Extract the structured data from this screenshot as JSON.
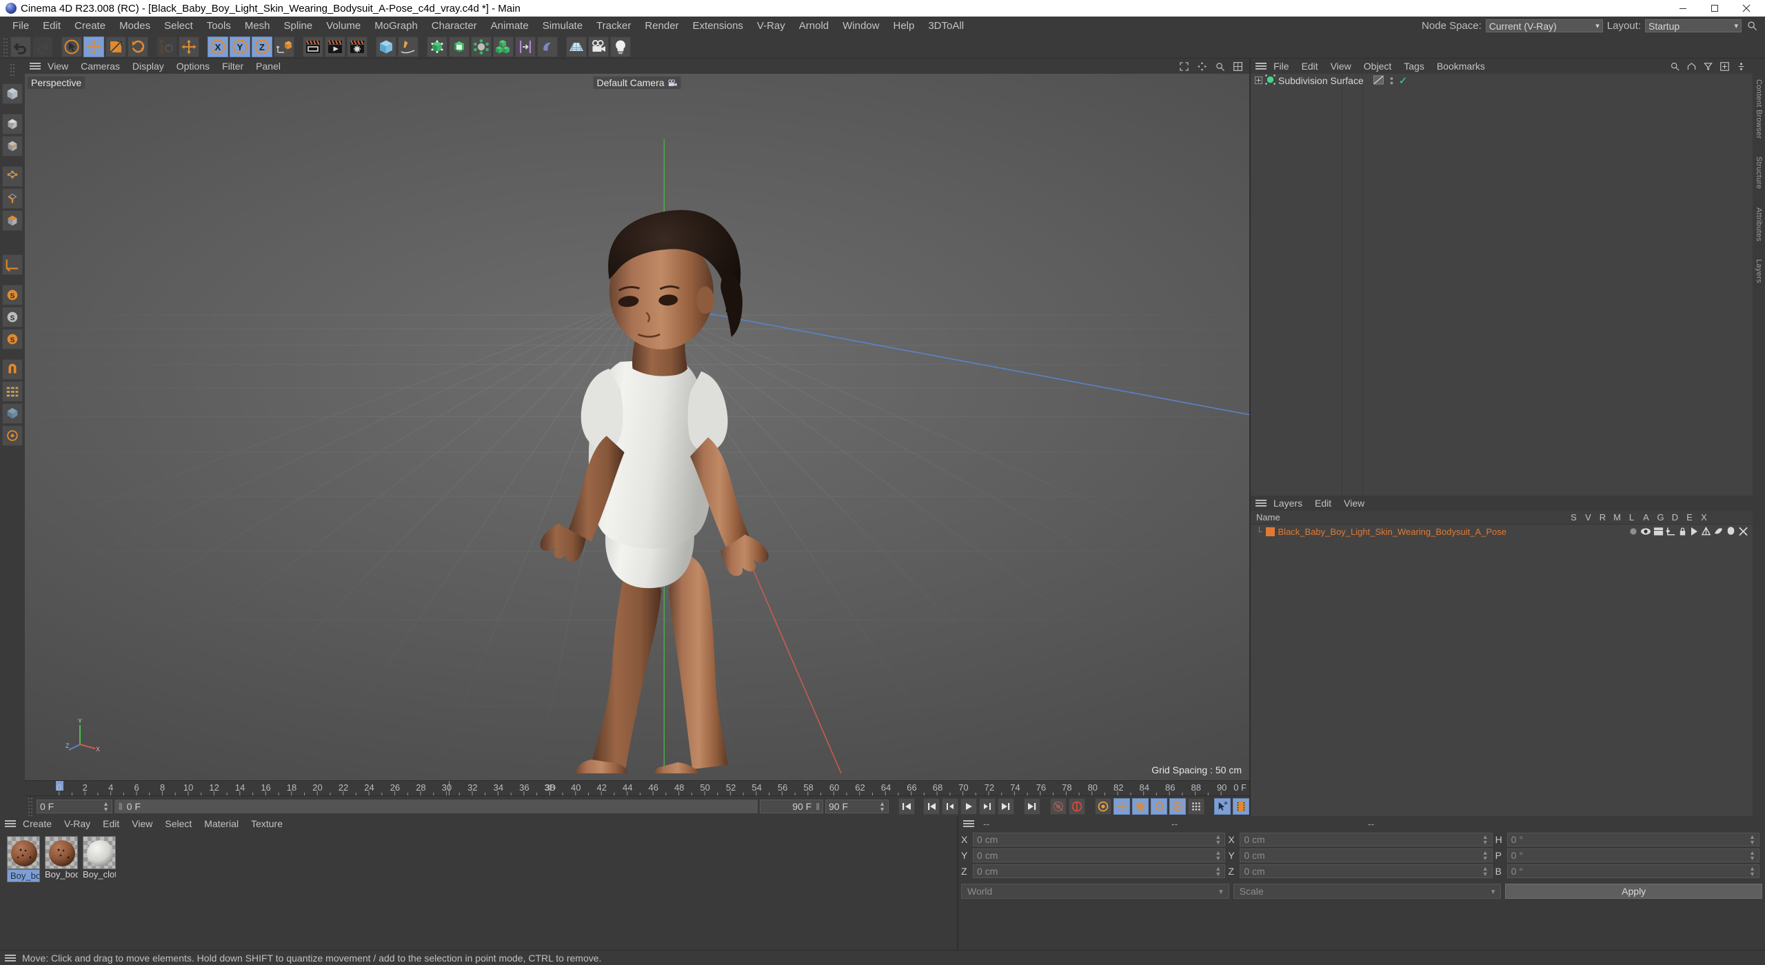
{
  "window": {
    "title": "Cinema 4D R23.008 (RC) - [Black_Baby_Boy_Light_Skin_Wearing_Bodysuit_A-Pose_c4d_vray.c4d *] - Main",
    "minimize": "–",
    "maximize": "❐",
    "close": "✕"
  },
  "menubar": {
    "items": [
      "File",
      "Edit",
      "Create",
      "Modes",
      "Select",
      "Tools",
      "Mesh",
      "Spline",
      "Volume",
      "MoGraph",
      "Character",
      "Animate",
      "Simulate",
      "Tracker",
      "Render",
      "Extensions",
      "V-Ray",
      "Arnold",
      "Window",
      "Help",
      "3DToAll"
    ]
  },
  "topright": {
    "node_space_label": "Node Space:",
    "node_space_value": "Current (V-Ray)",
    "layout_label": "Layout:",
    "layout_value": "Startup",
    "search_icon": "search-icon"
  },
  "toolbar": {
    "groups": [
      {
        "buttons": [
          {
            "name": "undo-button",
            "icon": "undo",
            "state": "normal"
          },
          {
            "name": "redo-button",
            "icon": "redo",
            "state": "disabled"
          }
        ]
      },
      {
        "buttons": [
          {
            "name": "live-selection-tool",
            "icon": "cursor-circle",
            "state": "normal"
          },
          {
            "name": "move-tool",
            "icon": "move",
            "state": "active"
          },
          {
            "name": "scale-tool",
            "icon": "scale",
            "state": "normal"
          },
          {
            "name": "rotate-tool",
            "icon": "rotate",
            "state": "normal"
          }
        ]
      },
      {
        "buttons": [
          {
            "name": "psr-dropdown",
            "icon": "psr",
            "state": "disabled"
          },
          {
            "name": "move-alt-tool",
            "icon": "move",
            "state": "normal"
          }
        ]
      },
      {
        "buttons": [
          {
            "name": "x-axis-lock",
            "icon": "axis-x",
            "state": "active"
          },
          {
            "name": "y-axis-lock",
            "icon": "axis-y",
            "state": "active"
          },
          {
            "name": "z-axis-lock",
            "icon": "axis-z",
            "state": "active"
          },
          {
            "name": "world-object-axis",
            "icon": "world-axis",
            "state": "normal"
          }
        ]
      },
      {
        "buttons": [
          {
            "name": "render-view-button",
            "icon": "render-view",
            "state": "normal"
          },
          {
            "name": "render-to-picture-viewer-button",
            "icon": "render-picture",
            "state": "normal"
          },
          {
            "name": "render-settings-button",
            "icon": "render-settings",
            "state": "normal"
          }
        ]
      },
      {
        "buttons": [
          {
            "name": "add-cube-button",
            "icon": "cube-blue",
            "state": "normal"
          },
          {
            "name": "add-spline-button",
            "icon": "pen",
            "state": "normal"
          }
        ]
      },
      {
        "buttons": [
          {
            "name": "add-nurbs-button",
            "icon": "nurbs",
            "state": "normal"
          },
          {
            "name": "add-array-button",
            "icon": "array",
            "state": "normal"
          },
          {
            "name": "add-deformer-button",
            "icon": "deformer",
            "state": "normal"
          },
          {
            "name": "add-mograph-button",
            "icon": "mograph",
            "state": "normal"
          },
          {
            "name": "add-field-button",
            "icon": "field",
            "state": "normal"
          },
          {
            "name": "add-scene-button",
            "icon": "scene",
            "state": "normal"
          }
        ]
      },
      {
        "buttons": [
          {
            "name": "add-floor-button",
            "icon": "floor",
            "state": "normal"
          },
          {
            "name": "add-camera-button",
            "icon": "camera",
            "state": "normal"
          },
          {
            "name": "add-light-button",
            "icon": "light",
            "state": "normal"
          }
        ]
      }
    ]
  },
  "lefttoolbar": {
    "buttons": [
      {
        "name": "make-editable-button",
        "icon": "make-editable"
      },
      {
        "name": "model-mode-button",
        "icon": "model-mode"
      },
      {
        "name": "texture-mode-button",
        "icon": "texture-mode"
      },
      {
        "name": "points-mode-button",
        "icon": "points-mode"
      },
      {
        "name": "edges-mode-button",
        "icon": "edges-mode"
      },
      {
        "name": "polygons-mode-button",
        "icon": "polygons-mode"
      },
      {
        "name": "workplane-button",
        "icon": "workplane"
      },
      {
        "name": "axis-lock-button",
        "icon": "axis-lock"
      },
      {
        "name": "enable-axis-button",
        "icon": "enable-axis"
      },
      {
        "name": "viewport-solo-single-button",
        "icon": "solo-single"
      },
      {
        "name": "viewport-solo-hierarchy-button",
        "icon": "solo-hierarchy"
      },
      {
        "name": "viewport-solo-off-button",
        "icon": "solo-off"
      },
      {
        "name": "snap-button",
        "icon": "snap-magnet"
      },
      {
        "name": "quantize-button",
        "icon": "quantize"
      },
      {
        "name": "workplane-lock-button",
        "icon": "workplane-lock"
      },
      {
        "name": "layout-preset-button",
        "icon": "layout-preset"
      }
    ]
  },
  "viewport": {
    "menu": [
      "View",
      "Cameras",
      "Display",
      "Options",
      "Filter",
      "Panel"
    ],
    "perspective_label": "Perspective",
    "camera_label": "Default Camera",
    "camera_icon": "camera-icon",
    "grid_spacing": "Grid Spacing : 50 cm",
    "axis_gizmo": {
      "y": "Y",
      "z": "Z",
      "x": "X"
    }
  },
  "timeline": {
    "ticks": [
      0,
      2,
      4,
      6,
      8,
      10,
      12,
      14,
      16,
      18,
      20,
      22,
      24,
      26,
      28,
      30,
      32,
      34,
      36,
      38,
      40,
      42,
      44,
      46,
      48,
      50,
      52,
      54,
      56,
      58,
      60,
      62,
      64,
      66,
      68,
      70,
      72,
      74,
      76,
      78,
      80,
      82,
      84,
      86,
      88,
      90
    ],
    "tick_3d_label": "3D",
    "current_frame_label": "0 F",
    "playhead_frame": 0,
    "cursor_frame": 30
  },
  "transport": {
    "current_frame": "0 F",
    "preview_range": "0 F",
    "end_frame": "90 F",
    "max_frame": "90 F",
    "buttons": [
      {
        "name": "go-to-start-button",
        "icon": "skip-start"
      },
      {
        "name": "go-to-previous-key-button",
        "icon": "prev-key"
      },
      {
        "name": "go-to-previous-frame-button",
        "icon": "prev-frame"
      },
      {
        "name": "play-button",
        "icon": "play"
      },
      {
        "name": "go-to-next-frame-button",
        "icon": "next-frame"
      },
      {
        "name": "go-to-next-key-button",
        "icon": "next-key"
      },
      {
        "name": "go-to-end-button",
        "icon": "skip-end"
      },
      {
        "name": "record-active-objects-button",
        "icon": "record-disabled"
      },
      {
        "name": "autokeying-button",
        "icon": "autokey"
      },
      {
        "name": "keyframe-selection-button",
        "icon": "keyframe-selection"
      },
      {
        "name": "position-key-button",
        "icon": "position-key"
      },
      {
        "name": "scale-key-button",
        "icon": "scale-key"
      },
      {
        "name": "rotation-key-button",
        "icon": "rotation-key"
      },
      {
        "name": "parameter-key-button",
        "icon": "param-key"
      },
      {
        "name": "point-level-animation-button",
        "icon": "pla"
      },
      {
        "name": "animation-mode-button",
        "icon": "anim-mode"
      },
      {
        "name": "timeline-filmstrip-button",
        "icon": "filmstrip"
      }
    ]
  },
  "material_manager": {
    "menu": [
      "Create",
      "V-Ray",
      "Edit",
      "View",
      "Select",
      "Material",
      "Texture"
    ],
    "materials": [
      {
        "name": "Boy_bod",
        "selected": true,
        "kind": "skin"
      },
      {
        "name": "Boy_bod",
        "selected": false,
        "kind": "skin"
      },
      {
        "name": "Boy_clot",
        "selected": false,
        "kind": "cloth"
      }
    ]
  },
  "coordinates": {
    "header_segments": [
      "--",
      "--",
      "--"
    ],
    "rows": [
      {
        "a_axis": "X",
        "a_value": "0 cm",
        "b_axis": "X",
        "b_value": "0 cm",
        "c_axis": "H",
        "c_value": "0 °"
      },
      {
        "a_axis": "Y",
        "a_value": "0 cm",
        "b_axis": "Y",
        "b_value": "0 cm",
        "c_axis": "P",
        "c_value": "0 °"
      },
      {
        "a_axis": "Z",
        "a_value": "0 cm",
        "b_axis": "Z",
        "b_value": "0 cm",
        "c_axis": "B",
        "c_value": "0 °"
      }
    ],
    "coord_system": "World",
    "mode": "Scale",
    "apply_label": "Apply"
  },
  "object_manager": {
    "menu": [
      "File",
      "Edit",
      "View",
      "Object",
      "Tags",
      "Bookmarks"
    ],
    "right_icons": [
      "search-icon",
      "home-icon",
      "filter-icon",
      "plus-icon",
      "more-icon"
    ],
    "items": [
      {
        "label": "Subdivision Surface",
        "expand": "+",
        "tag_icon": "subdivision-tag",
        "visible_dots": true,
        "check": "✓"
      }
    ]
  },
  "layer_manager": {
    "menu": [
      "Layers",
      "Edit",
      "View"
    ],
    "columns": [
      "Name",
      "S",
      "V",
      "R",
      "M",
      "L",
      "A",
      "G",
      "D",
      "E",
      "X"
    ],
    "rows": [
      {
        "name": "Black_Baby_Boy_Light_Skin_Wearing_Bodysuit_A_Pose",
        "color": "#e07a33"
      }
    ]
  },
  "right_rail_tabs": [
    "Content Browser",
    "Structure",
    "Attributes",
    "Layers"
  ],
  "statusbar": {
    "text": "Move: Click and drag to move elements. Hold down SHIFT to quantize movement / add to the selection in point mode, CTRL to remove."
  },
  "colors": {
    "accent_blue": "#7e9fd4",
    "orange": "#e08a2e",
    "layer_orange": "#e07a33",
    "panel_bg": "#3a3a3a",
    "list_bg": "#434343",
    "green_axis": "#46c24a",
    "red_axis": "#d05a52",
    "blue_axis": "#5a86d0"
  }
}
